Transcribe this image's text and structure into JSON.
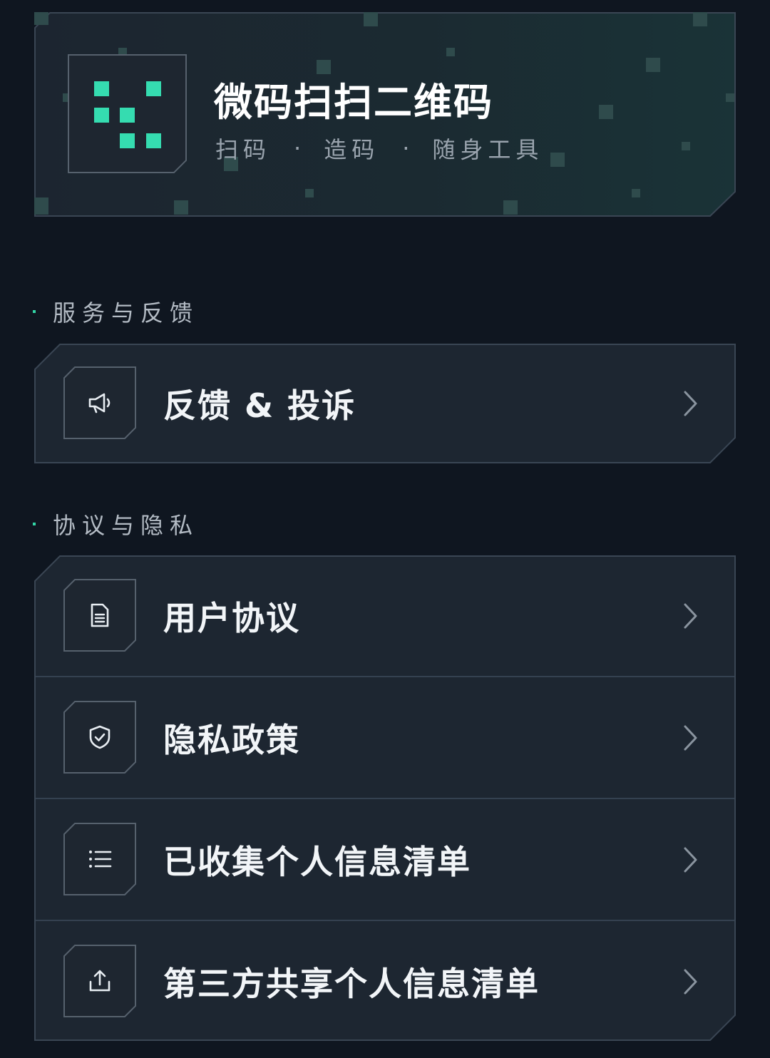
{
  "header": {
    "app_name": "微码扫扫二维码",
    "tagline": [
      "扫码",
      "造码",
      "随身工具"
    ],
    "tagline_separator": "·",
    "logo_icon": "qr-pixel-logo-icon"
  },
  "colors": {
    "background": "#0f1620",
    "card": "#1d2631",
    "card_border": "#3a4654",
    "accent": "#33d6a6",
    "text_primary": "#f2f5f8",
    "text_secondary": "#9aa4ae"
  },
  "sections": [
    {
      "title": "服务与反馈",
      "items": [
        {
          "label": "反馈 & 投诉",
          "icon": "megaphone-icon"
        }
      ]
    },
    {
      "title": "协议与隐私",
      "items": [
        {
          "label": "用户协议",
          "icon": "document-icon"
        },
        {
          "label": "隐私政策",
          "icon": "shield-check-icon"
        },
        {
          "label": "已收集个人信息清单",
          "icon": "list-icon"
        },
        {
          "label": "第三方共享个人信息清单",
          "icon": "share-upload-icon"
        }
      ]
    }
  ]
}
